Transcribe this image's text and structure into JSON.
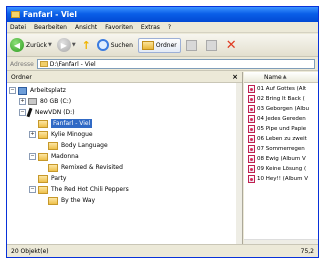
{
  "window": {
    "title": "Fanfarl - Viel"
  },
  "menu": [
    "Datei",
    "Bearbeiten",
    "Ansicht",
    "Favoriten",
    "Extras",
    "?"
  ],
  "toolbar": {
    "back_label": "Zurück",
    "search_label": "Suchen",
    "folders_label": "Ordner"
  },
  "address": {
    "label": "Adresse",
    "value": "D:\\Fanfarl - Viel"
  },
  "folders_pane": {
    "title": "Ordner"
  },
  "tree": [
    {
      "label": "Arbeitsplatz",
      "icon": "computer-icon",
      "expander": "−"
    },
    {
      "label": "80 GB (C:)",
      "icon": "drive-icon",
      "expander": "+"
    },
    {
      "label": "NewVDN (D:)",
      "icon": "cd-drive-icon",
      "expander": "−"
    },
    {
      "label": "Fanfarl - Viel",
      "icon": "folder-icon",
      "expander": "",
      "selected": true
    },
    {
      "label": "Kylie Minogue",
      "icon": "folder-icon",
      "expander": "+"
    },
    {
      "label": "Body Language",
      "icon": "folder-icon",
      "expander": ""
    },
    {
      "label": "Madonna",
      "icon": "folder-icon",
      "expander": "−"
    },
    {
      "label": "Remixed & Revisited",
      "icon": "folder-icon",
      "expander": ""
    },
    {
      "label": "Party",
      "icon": "folder-icon",
      "expander": ""
    },
    {
      "label": "The Red Hot Chili Peppers",
      "icon": "folder-icon",
      "expander": "−"
    },
    {
      "label": "By the Way",
      "icon": "folder-icon",
      "expander": ""
    }
  ],
  "files_pane": {
    "column_name": "Name"
  },
  "files": [
    "01 Auf Gottes (Alt",
    "02 Bring It Back (",
    "03 Geborgen (Albu",
    "04 Jedes Gereden",
    "05 Pipe und Papie",
    "06 Leben zu zweit",
    "07 Sommerregen",
    "08 Ewig (Album V",
    "09 Keine Lösung (",
    "10 Hey!! (Album V"
  ],
  "status": {
    "objects": "20 Objekt(e)",
    "size": "75,2"
  }
}
